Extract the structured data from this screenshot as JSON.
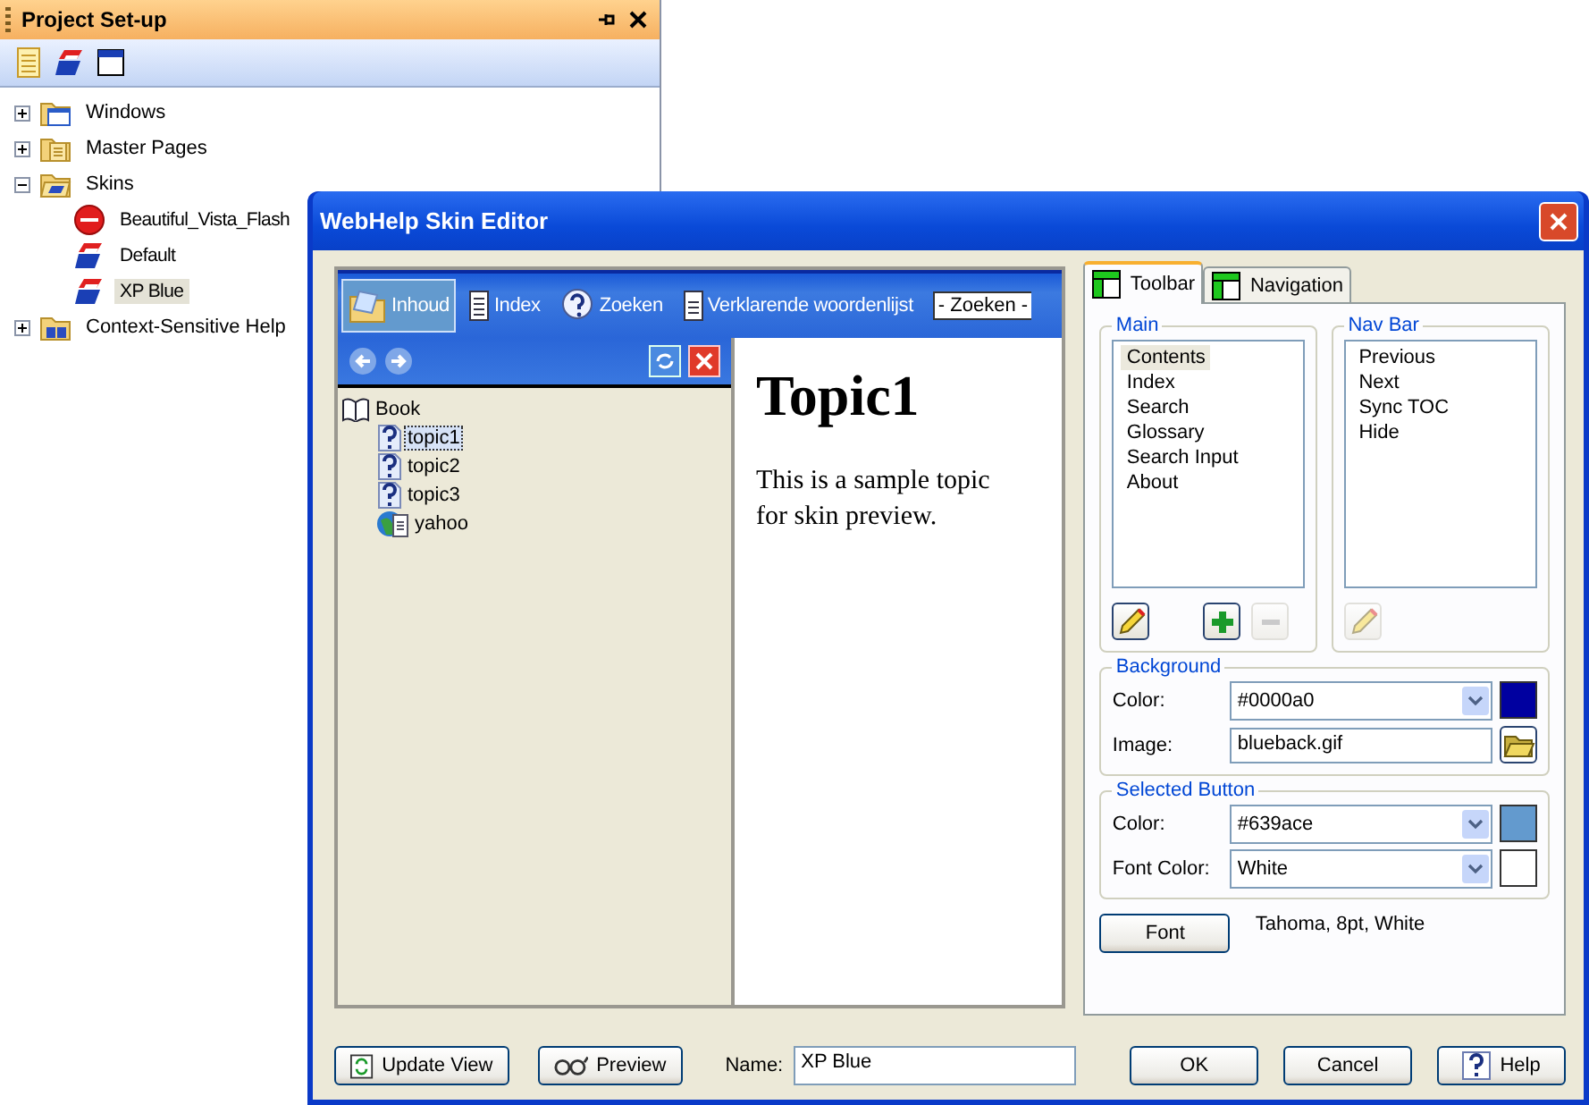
{
  "panel": {
    "title": "Project Set-up",
    "tree": [
      {
        "label": "Windows",
        "kind": "windows",
        "expanded": false,
        "selected": false
      },
      {
        "label": "Master Pages",
        "kind": "pages",
        "expanded": false,
        "selected": false
      },
      {
        "label": "Skins",
        "kind": "skins",
        "expanded": true,
        "selected": false,
        "children": [
          {
            "label": "Beautiful_Vista_Flash",
            "kind": "flash",
            "selected": false
          },
          {
            "label": "Default",
            "kind": "skin",
            "selected": false
          },
          {
            "label": "XP Blue",
            "kind": "skin",
            "selected": true
          }
        ]
      },
      {
        "label": "Context-Sensitive Help",
        "kind": "csh",
        "expanded": false,
        "selected": false
      }
    ]
  },
  "dialog": {
    "title": "WebHelp Skin Editor",
    "preview": {
      "tabs": [
        {
          "label": "Inhoud",
          "kind": "contents",
          "selected": true
        },
        {
          "label": "Index",
          "kind": "index",
          "selected": false
        },
        {
          "label": "Zoeken",
          "kind": "search",
          "selected": false
        },
        {
          "label": "Verklarende woordenlijst",
          "kind": "glossary",
          "selected": false
        }
      ],
      "search": {
        "value": "- Zoeken -"
      },
      "toc": [
        {
          "label": "Book",
          "kind": "book",
          "selected": false,
          "children": [
            {
              "label": "topic1",
              "kind": "topic",
              "selected": true
            },
            {
              "label": "topic2",
              "kind": "topic",
              "selected": false
            },
            {
              "label": "topic3",
              "kind": "topic",
              "selected": false
            },
            {
              "label": "yahoo",
              "kind": "link",
              "selected": false
            }
          ]
        }
      ],
      "topic": {
        "heading": "Topic1",
        "body": "This is a sample topic for skin preview."
      }
    },
    "tabs": [
      {
        "label": "Toolbar",
        "selected": true
      },
      {
        "label": "Navigation",
        "selected": false
      }
    ],
    "main": {
      "title": "Main",
      "items": [
        {
          "label": "Contents",
          "selected": true
        },
        {
          "label": "Index",
          "selected": false
        },
        {
          "label": "Search",
          "selected": false
        },
        {
          "label": "Glossary",
          "selected": false
        },
        {
          "label": "Search Input",
          "selected": false
        },
        {
          "label": "About",
          "selected": false
        }
      ],
      "buttons": [
        {
          "kind": "edit",
          "disabled": false
        },
        {
          "kind": "add",
          "disabled": false
        },
        {
          "kind": "remove",
          "disabled": true
        }
      ]
    },
    "nav_bar": {
      "title": "Nav Bar",
      "items": [
        {
          "label": "Previous",
          "selected": false
        },
        {
          "label": "Next",
          "selected": false
        },
        {
          "label": "Sync TOC",
          "selected": false
        },
        {
          "label": "Hide",
          "selected": false
        }
      ],
      "buttons": [
        {
          "kind": "edit",
          "disabled": true
        }
      ]
    },
    "background": {
      "title": "Background",
      "color_label": "Color:",
      "color": "#0000a0",
      "image_label": "Image:",
      "image": "blueback.gif"
    },
    "selected_button": {
      "title": "Selected Button",
      "color_label": "Color:",
      "color": "#639ace",
      "font_color_label": "Font Color:",
      "font_color": "White"
    },
    "font_button": "Font",
    "font_desc": "Tahoma, 8pt, White",
    "update_button": "Update View",
    "preview_button": "Preview",
    "name_label": "Name:",
    "name": "XP Blue",
    "ok_button": "OK",
    "cancel_button": "Cancel",
    "help_button": "Help"
  }
}
